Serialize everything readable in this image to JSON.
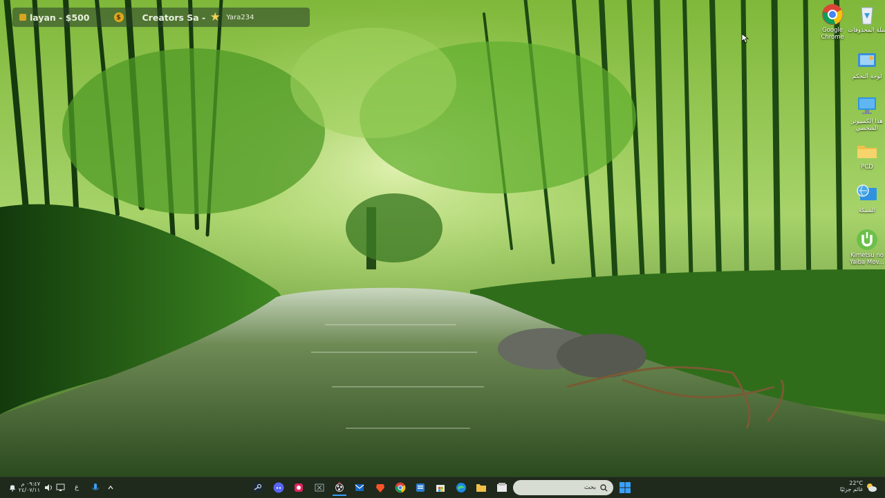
{
  "overlay": {
    "left_label": "layan - $500",
    "coin_symbol": "$",
    "middle_label": "Creators Sa -",
    "right_label": "Yara234"
  },
  "desktop_icons": [
    {
      "name": "chrome",
      "label": "Google Chrome",
      "icon": "chrome-icon"
    },
    {
      "name": "recycle-bin",
      "label": "سلة المحذوفات",
      "icon": "recycle-bin-icon"
    },
    {
      "name": "control-panel",
      "label": "لوحة التحكم",
      "icon": "control-panel-icon"
    },
    {
      "name": "this-pc",
      "label": "هذا الكمبيوتر الشخصي",
      "icon": "monitor-icon"
    },
    {
      "name": "pcd-folder",
      "label": "PCD",
      "icon": "folder-icon"
    },
    {
      "name": "network",
      "label": "الشبكة",
      "icon": "network-icon"
    },
    {
      "name": "utorrent",
      "label": "Kimetsu no Yaiba Mov...",
      "icon": "utorrent-icon"
    }
  ],
  "taskbar": {
    "weather_temp": "22°C",
    "weather_desc": "غائم جزئيًا",
    "search_placeholder": "بحث",
    "clock_time": "٠٩:٤٧ م",
    "clock_date": "٢٤/٠٧/١١",
    "language": "ع",
    "apps": [
      "start-icon",
      "file-explorer-icon",
      "file-manager-icon",
      "edge-icon",
      "store-icon",
      "word-icon",
      "chrome-icon",
      "brave-icon",
      "outlook-icon",
      "obs-icon",
      "close-app-icon",
      "app-red-icon",
      "discord-icon",
      "steam-icon"
    ]
  },
  "colors": {
    "taskbar_bg": "#1f2a1c",
    "accent": "#3aa0ff",
    "overlay_bg": "#2c3c2c"
  }
}
